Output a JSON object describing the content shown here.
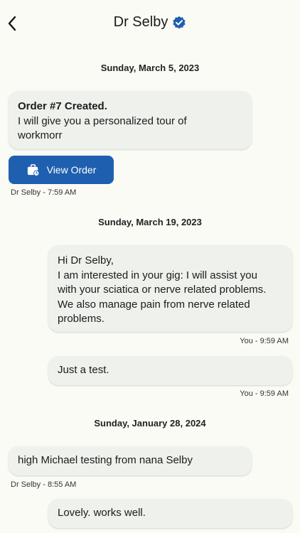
{
  "header": {
    "title": "Dr Selby",
    "icons": {
      "back": "chevron-left-icon",
      "verified": "verified-badge-icon"
    }
  },
  "colors": {
    "accent": "#1f5fb0",
    "background": "#fbfbf6",
    "bubble": "#eef1ec",
    "verified": "#1f5fb0"
  },
  "messages": {
    "date1": "Sunday, March 5, 2023",
    "order": {
      "title": "Order #7 Created.",
      "line1": "I will give you a personalized tour of",
      "line2": "workmorr",
      "button_label": "View Order",
      "button_icon": "shopping-bag-clock-icon",
      "meta": "Dr Selby - 7:59 AM"
    },
    "date2": "Sunday, March 19, 2023",
    "msg1": {
      "line1": "Hi Dr Selby,",
      "line2": "I am interested in your gig: I will assist you",
      "line3": "with your sciatica or nerve related problems.",
      "line4": "We also manage pain from nerve related",
      "line5": "problems.",
      "meta": "You - 9:59 AM"
    },
    "msg2": {
      "text": "Just a test.",
      "meta": "You - 9:59 AM"
    },
    "date3": "Sunday, January 28, 2024",
    "msg3": {
      "text": "high Michael testing from nana Selby",
      "meta": "Dr Selby - 8:55 AM"
    },
    "msg4": {
      "text": "Lovely. works well."
    }
  }
}
